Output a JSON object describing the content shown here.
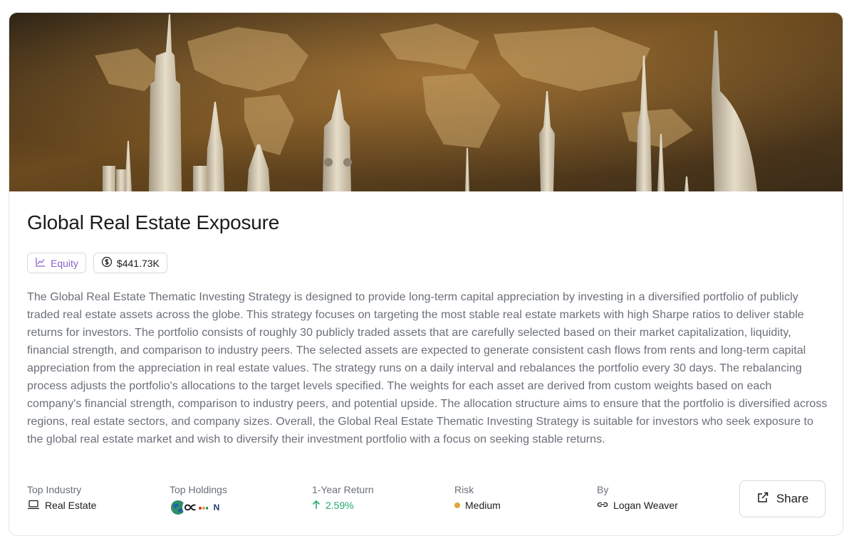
{
  "strategy": {
    "title": "Global Real Estate Exposure",
    "hero_image": "world-map-skyline-landmarks-image",
    "badges": {
      "asset_class": "Equity",
      "asset_class_icon": "line-chart-icon",
      "aum": "$441.73K",
      "aum_icon": "dollar-coin-icon"
    },
    "description": "The Global Real Estate Thematic Investing Strategy is designed to provide long-term capital appreciation by investing in a diversified portfolio of publicly traded real estate assets across the globe. This strategy focuses on targeting the most stable real estate markets with high Sharpe ratios to deliver stable returns for investors. The portfolio consists of roughly 30 publicly traded assets that are carefully selected based on their market capitalization, liquidity, financial strength, and comparison to industry peers. The selected assets are expected to generate consistent cash flows from rents and long-term capital appreciation from the appreciation in real estate values. The strategy runs on a daily interval and rebalances the portfolio every 30 days. The rebalancing process adjusts the portfolio's allocations to the target levels specified. The weights for each asset are derived from custom weights based on each company's financial strength, comparison to industry peers, and potential upside. The allocation structure aims to ensure that the portfolio is diversified across regions, real estate sectors, and company sizes. Overall, the Global Real Estate Thematic Investing Strategy is suitable for investors who seek exposure to the global real estate market and wish to diversify their investment portfolio with a focus on seeking stable returns.",
    "stats": {
      "industry_label": "Top Industry",
      "industry_value": "Real Estate",
      "industry_icon": "laptop-icon",
      "holdings_label": "Top Holdings",
      "holdings_logos": [
        "globe-logo",
        "infinity-logo",
        "dots-logo",
        "n-logo"
      ],
      "holdings_n_letter": "N",
      "return_label": "1-Year Return",
      "return_value": "2.59%",
      "return_icon": "arrow-up-icon",
      "risk_label": "Risk",
      "risk_value": "Medium",
      "risk_color": "#e2a33a",
      "author_label": "By",
      "author_value": "Logan Weaver",
      "author_icon": "link-icon"
    },
    "share_label": "Share",
    "share_icon": "external-link-icon"
  },
  "colors": {
    "positive": "#22a86a",
    "equity_badge": "#8a63c9"
  }
}
